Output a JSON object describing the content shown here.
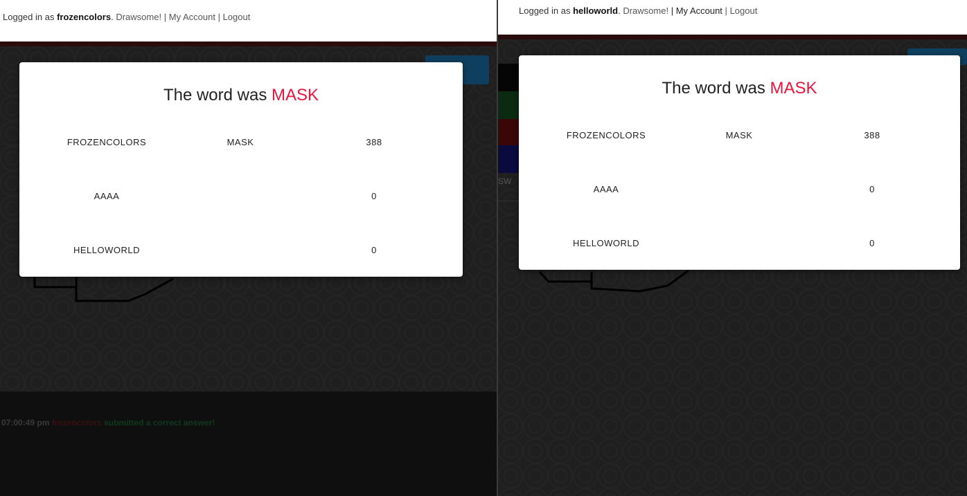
{
  "left": {
    "login": {
      "prefix": "Logged in as",
      "username": "frozencolors",
      "sep1": ".",
      "drawsome": "Drawsome!",
      "pipe1": "|",
      "account": "My Account",
      "pipe2": "|",
      "logout": "Logout"
    },
    "modal": {
      "title_prefix": "The word was",
      "word": "MASK",
      "rows": [
        {
          "player": "FROZENCOLORS",
          "guess": "MASK",
          "score": "388"
        },
        {
          "player": "AAAA",
          "guess": "",
          "score": "0"
        },
        {
          "player": "HELLOWORLD",
          "guess": "",
          "score": "0"
        }
      ]
    },
    "chat": {
      "time": "07:00:49 pm",
      "user": "frozencolors",
      "message": "submitted a correct answer!"
    }
  },
  "right": {
    "login": {
      "prefix": "Logged in as",
      "username": "helloworld",
      "sep1": ".",
      "drawsome": "Drawsome!",
      "pipe1": "|",
      "account": "My Account",
      "pipe2": "|",
      "logout": "Logout"
    },
    "modal": {
      "title_prefix": "The word was",
      "word": "MASK",
      "rows": [
        {
          "player": "FROZENCOLORS",
          "guess": "MASK",
          "score": "388"
        },
        {
          "player": "AAAA",
          "guess": "",
          "score": "0"
        },
        {
          "player": "HELLOWORLD",
          "guess": "",
          "score": "0"
        }
      ]
    },
    "partial_label": "SW"
  },
  "colors": {
    "accent_word": "#e8163e",
    "topbar": "#ffffff",
    "modal_bg": "#ffffff"
  }
}
